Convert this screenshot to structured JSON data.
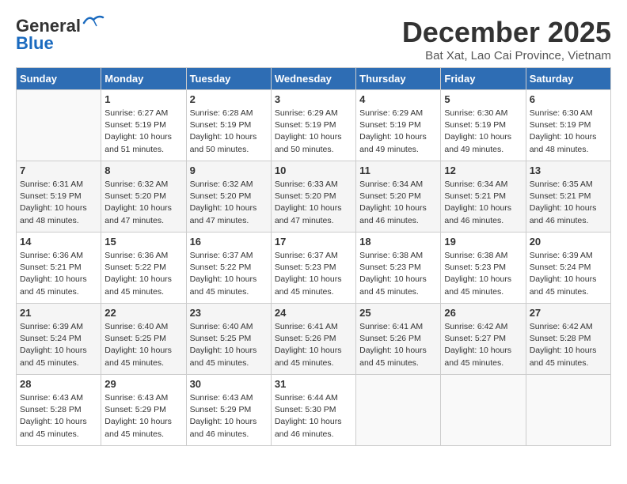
{
  "header": {
    "logo_general": "General",
    "logo_blue": "Blue",
    "month": "December 2025",
    "location": "Bat Xat, Lao Cai Province, Vietnam"
  },
  "days_of_week": [
    "Sunday",
    "Monday",
    "Tuesday",
    "Wednesday",
    "Thursday",
    "Friday",
    "Saturday"
  ],
  "weeks": [
    [
      {
        "day": "",
        "data": ""
      },
      {
        "day": "1",
        "data": "Sunrise: 6:27 AM\nSunset: 5:19 PM\nDaylight: 10 hours\nand 51 minutes."
      },
      {
        "day": "2",
        "data": "Sunrise: 6:28 AM\nSunset: 5:19 PM\nDaylight: 10 hours\nand 50 minutes."
      },
      {
        "day": "3",
        "data": "Sunrise: 6:29 AM\nSunset: 5:19 PM\nDaylight: 10 hours\nand 50 minutes."
      },
      {
        "day": "4",
        "data": "Sunrise: 6:29 AM\nSunset: 5:19 PM\nDaylight: 10 hours\nand 49 minutes."
      },
      {
        "day": "5",
        "data": "Sunrise: 6:30 AM\nSunset: 5:19 PM\nDaylight: 10 hours\nand 49 minutes."
      },
      {
        "day": "6",
        "data": "Sunrise: 6:30 AM\nSunset: 5:19 PM\nDaylight: 10 hours\nand 48 minutes."
      }
    ],
    [
      {
        "day": "7",
        "data": "Sunrise: 6:31 AM\nSunset: 5:19 PM\nDaylight: 10 hours\nand 48 minutes."
      },
      {
        "day": "8",
        "data": "Sunrise: 6:32 AM\nSunset: 5:20 PM\nDaylight: 10 hours\nand 47 minutes."
      },
      {
        "day": "9",
        "data": "Sunrise: 6:32 AM\nSunset: 5:20 PM\nDaylight: 10 hours\nand 47 minutes."
      },
      {
        "day": "10",
        "data": "Sunrise: 6:33 AM\nSunset: 5:20 PM\nDaylight: 10 hours\nand 47 minutes."
      },
      {
        "day": "11",
        "data": "Sunrise: 6:34 AM\nSunset: 5:20 PM\nDaylight: 10 hours\nand 46 minutes."
      },
      {
        "day": "12",
        "data": "Sunrise: 6:34 AM\nSunset: 5:21 PM\nDaylight: 10 hours\nand 46 minutes."
      },
      {
        "day": "13",
        "data": "Sunrise: 6:35 AM\nSunset: 5:21 PM\nDaylight: 10 hours\nand 46 minutes."
      }
    ],
    [
      {
        "day": "14",
        "data": "Sunrise: 6:36 AM\nSunset: 5:21 PM\nDaylight: 10 hours\nand 45 minutes."
      },
      {
        "day": "15",
        "data": "Sunrise: 6:36 AM\nSunset: 5:22 PM\nDaylight: 10 hours\nand 45 minutes."
      },
      {
        "day": "16",
        "data": "Sunrise: 6:37 AM\nSunset: 5:22 PM\nDaylight: 10 hours\nand 45 minutes."
      },
      {
        "day": "17",
        "data": "Sunrise: 6:37 AM\nSunset: 5:23 PM\nDaylight: 10 hours\nand 45 minutes."
      },
      {
        "day": "18",
        "data": "Sunrise: 6:38 AM\nSunset: 5:23 PM\nDaylight: 10 hours\nand 45 minutes."
      },
      {
        "day": "19",
        "data": "Sunrise: 6:38 AM\nSunset: 5:23 PM\nDaylight: 10 hours\nand 45 minutes."
      },
      {
        "day": "20",
        "data": "Sunrise: 6:39 AM\nSunset: 5:24 PM\nDaylight: 10 hours\nand 45 minutes."
      }
    ],
    [
      {
        "day": "21",
        "data": "Sunrise: 6:39 AM\nSunset: 5:24 PM\nDaylight: 10 hours\nand 45 minutes."
      },
      {
        "day": "22",
        "data": "Sunrise: 6:40 AM\nSunset: 5:25 PM\nDaylight: 10 hours\nand 45 minutes."
      },
      {
        "day": "23",
        "data": "Sunrise: 6:40 AM\nSunset: 5:25 PM\nDaylight: 10 hours\nand 45 minutes."
      },
      {
        "day": "24",
        "data": "Sunrise: 6:41 AM\nSunset: 5:26 PM\nDaylight: 10 hours\nand 45 minutes."
      },
      {
        "day": "25",
        "data": "Sunrise: 6:41 AM\nSunset: 5:26 PM\nDaylight: 10 hours\nand 45 minutes."
      },
      {
        "day": "26",
        "data": "Sunrise: 6:42 AM\nSunset: 5:27 PM\nDaylight: 10 hours\nand 45 minutes."
      },
      {
        "day": "27",
        "data": "Sunrise: 6:42 AM\nSunset: 5:28 PM\nDaylight: 10 hours\nand 45 minutes."
      }
    ],
    [
      {
        "day": "28",
        "data": "Sunrise: 6:43 AM\nSunset: 5:28 PM\nDaylight: 10 hours\nand 45 minutes."
      },
      {
        "day": "29",
        "data": "Sunrise: 6:43 AM\nSunset: 5:29 PM\nDaylight: 10 hours\nand 45 minutes."
      },
      {
        "day": "30",
        "data": "Sunrise: 6:43 AM\nSunset: 5:29 PM\nDaylight: 10 hours\nand 46 minutes."
      },
      {
        "day": "31",
        "data": "Sunrise: 6:44 AM\nSunset: 5:30 PM\nDaylight: 10 hours\nand 46 minutes."
      },
      {
        "day": "",
        "data": ""
      },
      {
        "day": "",
        "data": ""
      },
      {
        "day": "",
        "data": ""
      }
    ]
  ]
}
